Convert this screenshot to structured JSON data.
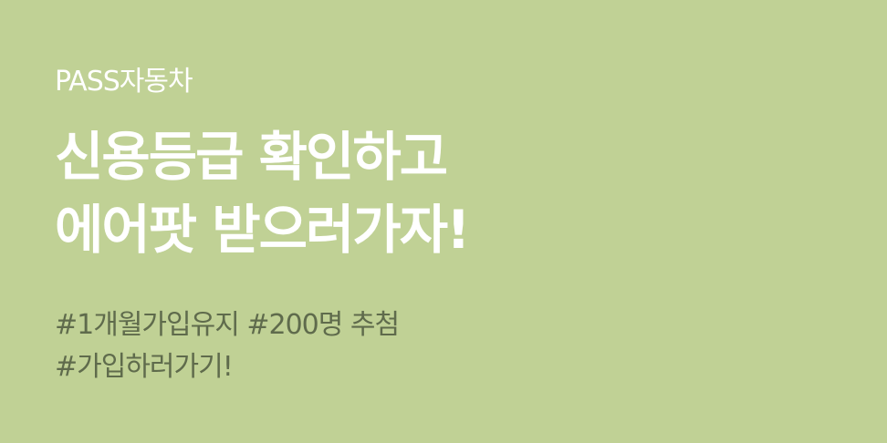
{
  "banner": {
    "brand": "PASS자동차",
    "headline": {
      "line1": "신용등급 확인하고",
      "line2": "에어팟 받으러가자!"
    },
    "tags": {
      "line1": "#1개월가입유지 #200명 추첨",
      "line2": "#가입하러가기!"
    },
    "colors": {
      "background": "#c0d195",
      "headline_text": "#ffffff",
      "tag_text": "#5f6b4c"
    }
  }
}
